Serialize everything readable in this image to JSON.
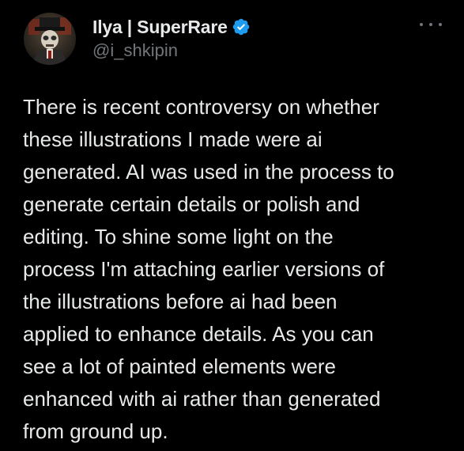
{
  "tweet": {
    "author": {
      "display_name": "Ilya | SuperRare",
      "handle": "@i_shkipin",
      "verified_icon": "verified-badge-icon",
      "avatar_icon": "avatar-portrait"
    },
    "more_icon": "more-options-icon",
    "text": "There is recent controversy on whether\nthese illustrations I made were ai\ngenerated. AI was used in the process to\ngenerate certain details or polish and\nediting. To shine some light on the\nprocess I'm attaching earlier versions of\nthe illustrations before ai had been\napplied to enhance details.  As you can\nsee a lot of painted elements were\nenhanced with ai rather than generated\nfrom ground up."
  },
  "colors": {
    "background": "#000000",
    "text_primary": "#e7e9ea",
    "text_secondary": "#71767b",
    "verified_blue": "#1d9bf0"
  }
}
